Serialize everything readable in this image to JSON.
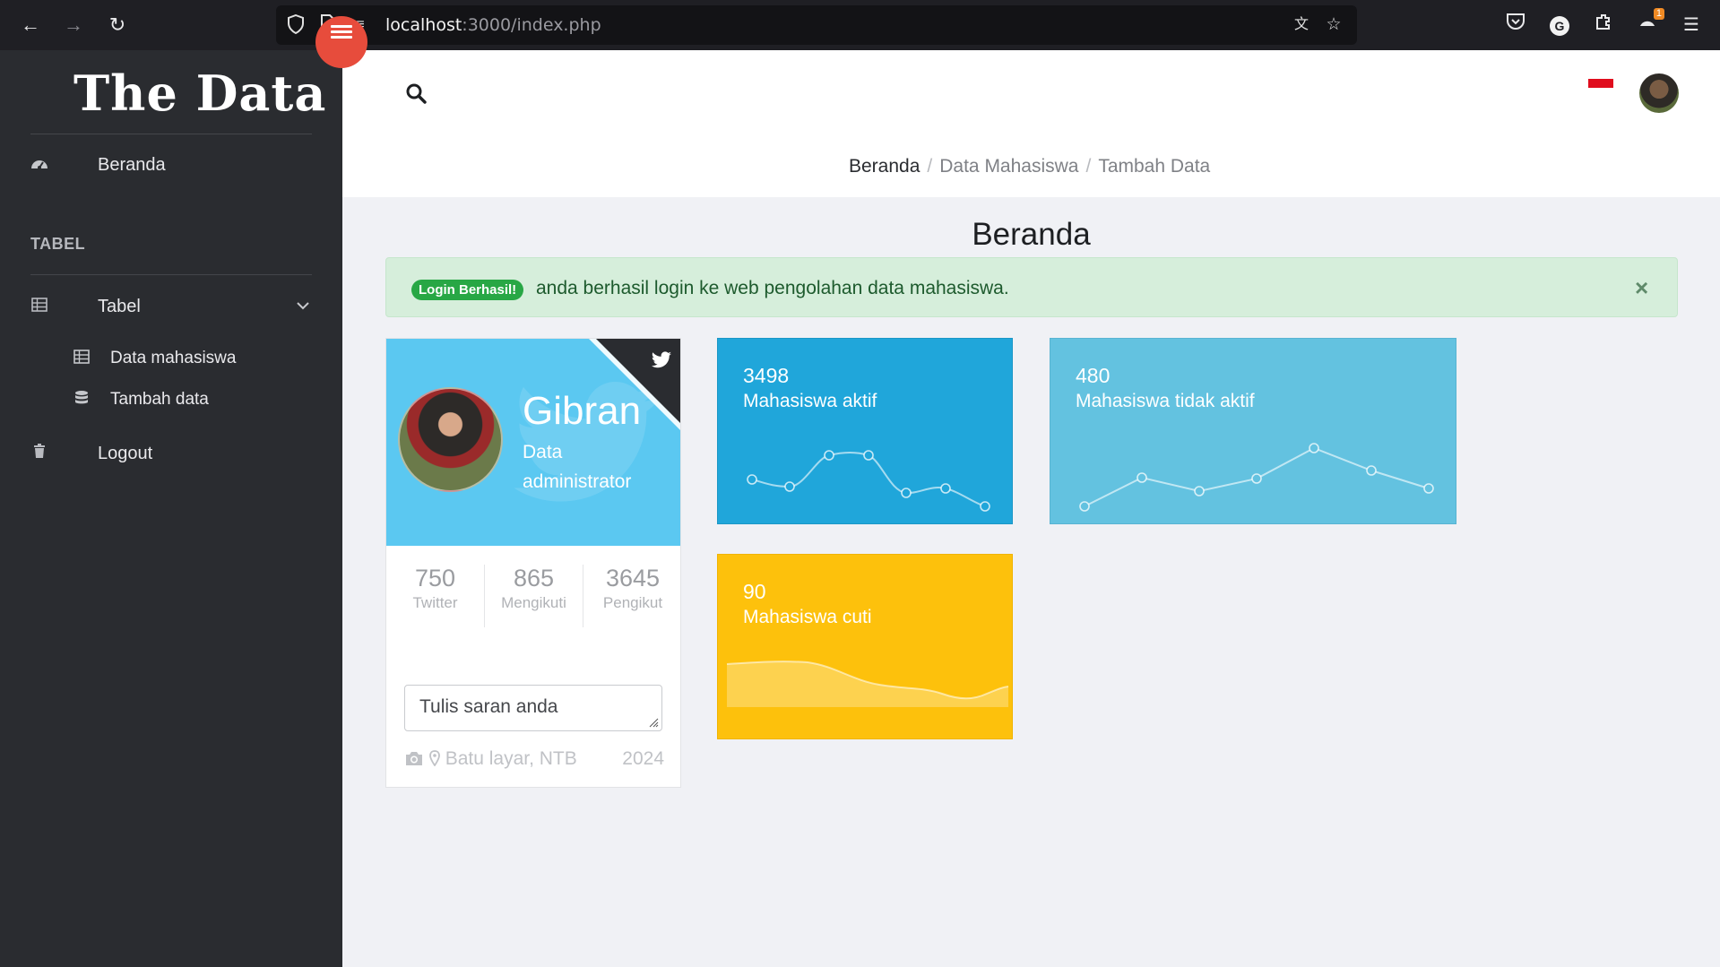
{
  "browser": {
    "url_host": "localhost",
    "url_path": ":3000/index.php"
  },
  "sidebar": {
    "brand": "The Data",
    "items": [
      {
        "label": "Beranda",
        "icon": "dashboard-icon"
      },
      {
        "label": "Tabel",
        "icon": "table-icon"
      },
      {
        "label": "Logout",
        "icon": "trash-icon"
      }
    ],
    "section_heading": "TABEL",
    "subitems": [
      {
        "label": "Data mahasiswa",
        "icon": "table-icon"
      },
      {
        "label": "Tambah data",
        "icon": "database-icon"
      }
    ]
  },
  "header": {
    "breadcrumb": [
      "Beranda",
      "Data Mahasiswa",
      "Tambah Data"
    ],
    "breadcrumb_sep": "/"
  },
  "main": {
    "title": "Beranda",
    "alert": {
      "badge": "Login Berhasil!",
      "message": "anda berhasil login ke web pengolahan data mahasiswa.",
      "close": "×"
    },
    "profile": {
      "name": "Gibran",
      "role": "Data administrator",
      "stats": [
        {
          "value": "750",
          "label": "Twitter"
        },
        {
          "value": "865",
          "label": "Mengikuti"
        },
        {
          "value": "3645",
          "label": "Pengikut"
        }
      ],
      "textarea_placeholder": "Tulis saran anda",
      "location": "Batu layar, NTB",
      "year": "2024"
    },
    "tiles": [
      {
        "value": "3498",
        "label": "Mahasiswa aktif",
        "color": "#20a6da"
      },
      {
        "value": "480",
        "label": "Mahasiswa tidak aktif",
        "color": "#63c2e0"
      },
      {
        "value": "90",
        "label": "Mahasiswa cuti",
        "color": "#fdc10c"
      }
    ]
  },
  "colors": {
    "sidebar_bg": "#2a2c30",
    "accent_red": "#e74c3c",
    "alert_green": "#28a745",
    "profile_head": "#5bc8f1"
  }
}
